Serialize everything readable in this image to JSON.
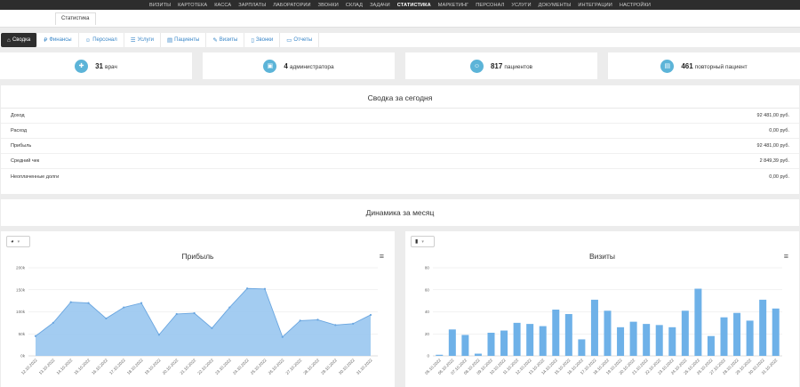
{
  "topnav": {
    "items": [
      {
        "label": "ВИЗИТЫ"
      },
      {
        "label": "КАРТОТЕКА"
      },
      {
        "label": "КАССА"
      },
      {
        "label": "ЗАРПЛАТЫ"
      },
      {
        "label": "ЛАБОРАТОРИИ"
      },
      {
        "label": "ЗВОНКИ"
      },
      {
        "label": "СКЛАД"
      },
      {
        "label": "ЗАДАЧИ"
      },
      {
        "label": "СТАТИСТИКА"
      },
      {
        "label": "МАРКЕТИНГ"
      },
      {
        "label": "ПЕРСОНАЛ"
      },
      {
        "label": "УСЛУГИ"
      },
      {
        "label": "ДОКУМЕНТЫ"
      },
      {
        "label": "ИНТЕГРАЦИИ"
      },
      {
        "label": "НАСТРОЙКИ"
      }
    ],
    "active": "СТАТИСТИКА"
  },
  "breadcrumb": "Статистика",
  "tabs": [
    {
      "label": "Сводка",
      "icon": "home-icon"
    },
    {
      "label": "Финансы",
      "icon": "ruble-icon"
    },
    {
      "label": "Персонал",
      "icon": "user-icon"
    },
    {
      "label": "Услуги",
      "icon": "list-icon"
    },
    {
      "label": "Пациенты",
      "icon": "id-card-icon"
    },
    {
      "label": "Визиты",
      "icon": "edit-icon"
    },
    {
      "label": "Звонки",
      "icon": "phone-icon"
    },
    {
      "label": "Отчеты",
      "icon": "document-icon"
    }
  ],
  "stats": [
    {
      "value": "31",
      "label": "врач",
      "icon": "medkit-icon"
    },
    {
      "value": "4",
      "label": "администратора",
      "icon": "briefcase-icon"
    },
    {
      "value": "817",
      "label": "пациентов",
      "icon": "person-icon"
    },
    {
      "value": "461",
      "label": "повторный пациент",
      "icon": "id-card-icon"
    }
  ],
  "summary": {
    "title": "Сводка за сегодня",
    "rows": [
      {
        "label": "Доход",
        "value": "92 481,00 руб."
      },
      {
        "label": "Расход",
        "value": "0,00 руб."
      },
      {
        "label": "Прибыль",
        "value": "92 481,00 руб."
      },
      {
        "label": "Средний чек",
        "value": "2 849,39 руб."
      },
      {
        "label": "Неоплаченные долги",
        "value": "0,00 руб."
      }
    ]
  },
  "dynamics_title": "Динамика за месяц",
  "colors": {
    "accent": "#5cb4d8",
    "area_fill": "#99c7f0",
    "area_line": "#6aa6e0",
    "bar": "#6eb1e8"
  },
  "chart_data": [
    {
      "type": "area",
      "title": "Прибыль",
      "categories": [
        "12.10.2022",
        "13.10.2022",
        "14.10.2022",
        "15.10.2022",
        "16.10.2022",
        "17.10.2022",
        "18.10.2022",
        "19.10.2022",
        "20.10.2022",
        "21.10.2022",
        "22.10.2022",
        "23.10.2022",
        "24.10.2022",
        "25.10.2022",
        "26.10.2022",
        "27.10.2022",
        "28.10.2022",
        "29.10.2022",
        "30.10.2022",
        "31.10.2022"
      ],
      "values": [
        45000,
        75000,
        122000,
        120000,
        85000,
        110000,
        120000,
        48000,
        95000,
        97000,
        63000,
        110000,
        153000,
        152000,
        43000,
        80000,
        82000,
        70000,
        73000,
        93000
      ],
      "yticks": [
        "0k",
        "50k",
        "100k",
        "150k",
        "200k"
      ],
      "ylim": [
        0,
        200000
      ],
      "grid": true
    },
    {
      "type": "bar",
      "title": "Визиты",
      "categories": [
        "05.10.2022",
        "06.10.2022",
        "07.10.2022",
        "08.10.2022",
        "09.10.2022",
        "10.10.2022",
        "11.10.2022",
        "12.10.2022",
        "13.10.2022",
        "14.10.2022",
        "15.10.2022",
        "16.10.2022",
        "17.10.2022",
        "18.10.2022",
        "19.10.2022",
        "20.10.2022",
        "21.10.2022",
        "22.10.2022",
        "23.10.2022",
        "24.10.2022",
        "25.10.2022",
        "26.10.2022",
        "27.10.2022",
        "28.10.2022",
        "29.10.2022",
        "30.10.2022",
        "31.10.2022"
      ],
      "values": [
        1,
        24,
        19,
        2,
        21,
        23,
        30,
        29,
        27,
        42,
        38,
        15,
        51,
        41,
        26,
        31,
        29,
        28,
        26,
        41,
        61,
        18,
        35,
        39,
        32,
        51,
        43
      ],
      "yticks": [
        "0",
        "20",
        "40",
        "60",
        "80"
      ],
      "ylim": [
        0,
        80
      ],
      "grid": true
    }
  ]
}
